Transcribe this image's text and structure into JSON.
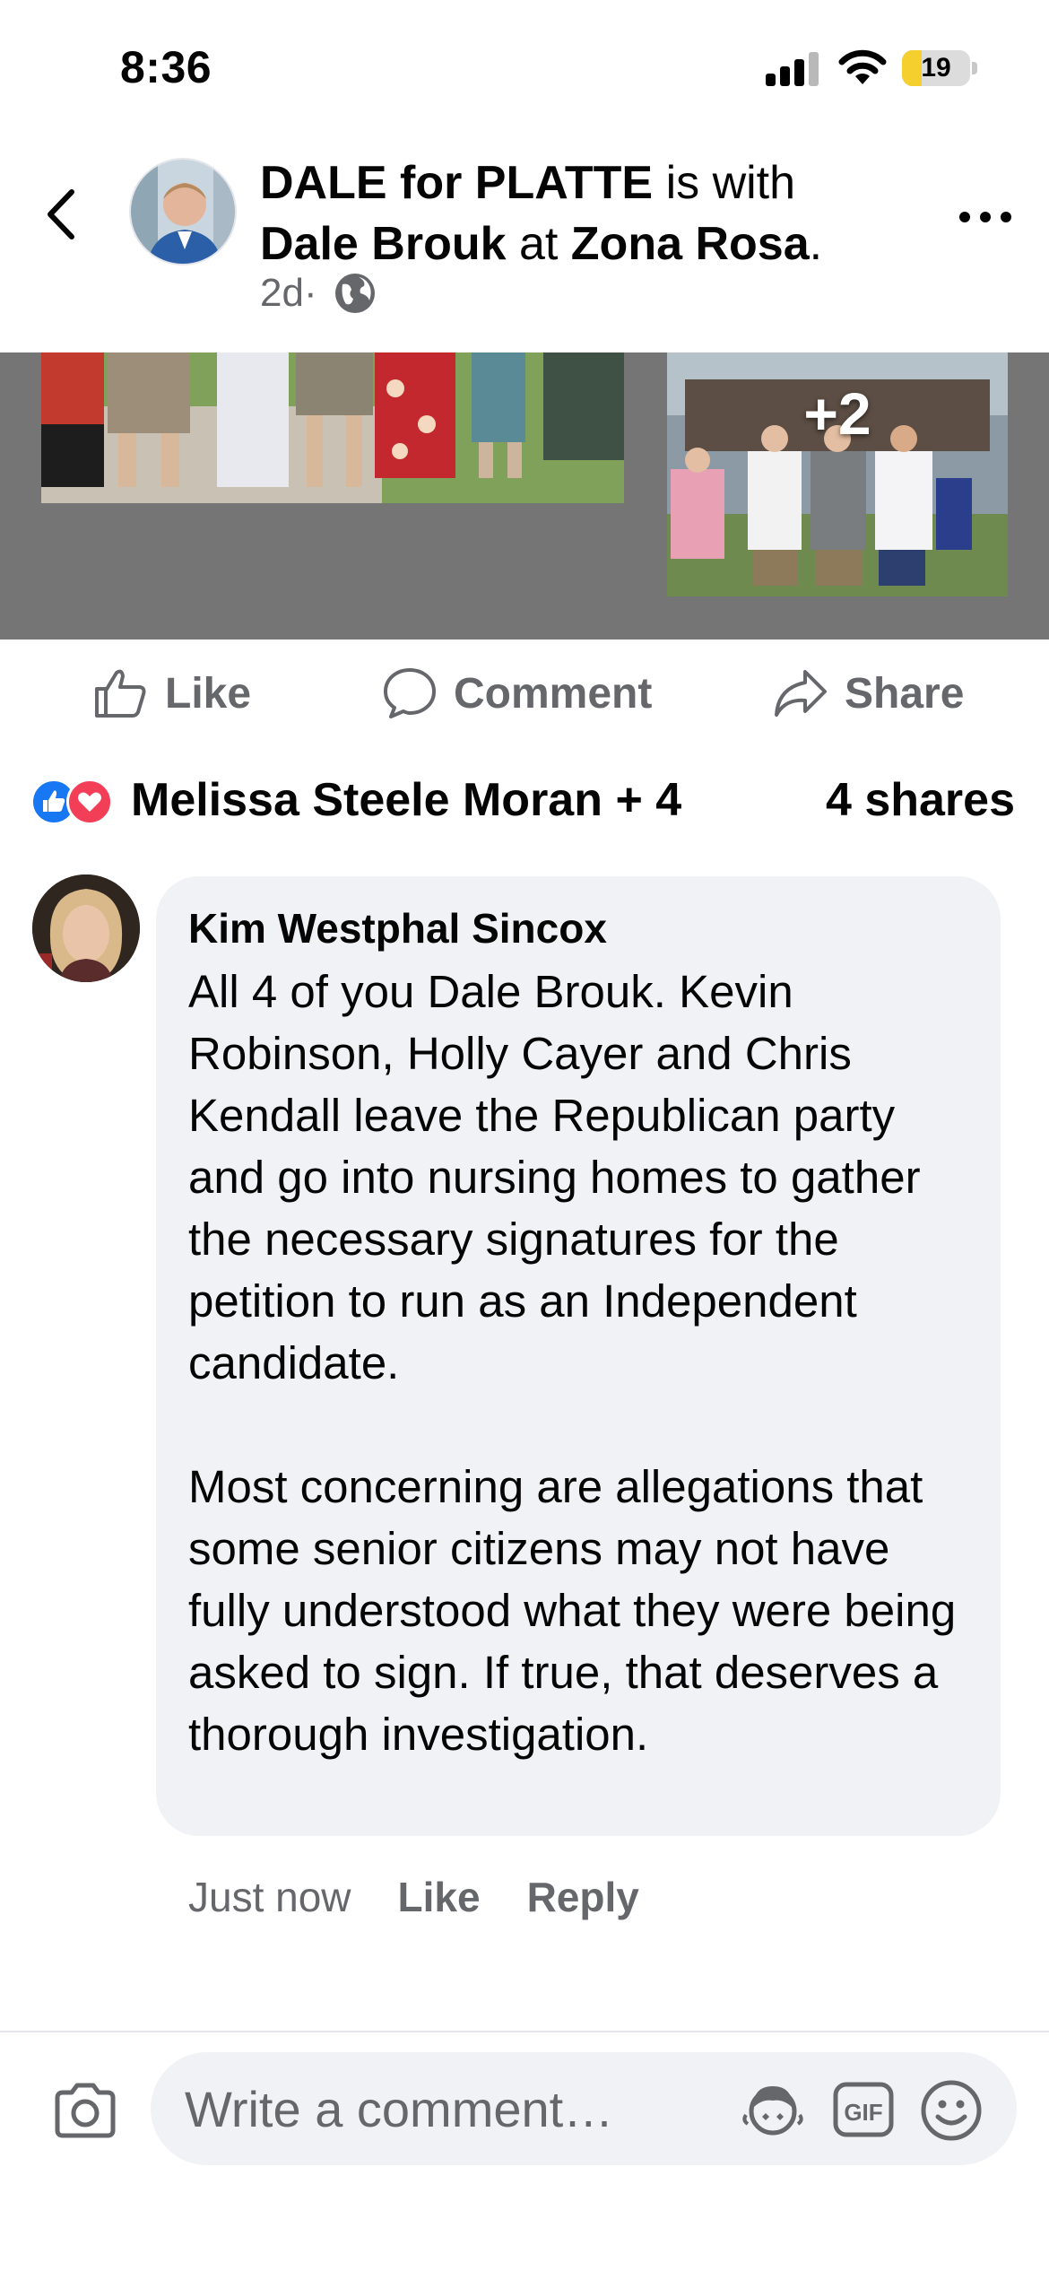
{
  "status_bar": {
    "time": "8:36",
    "battery_level": "19"
  },
  "post": {
    "page_name": "DALE for PLATTE",
    "is_with_text": " is with",
    "tagged_person": "Dale Brouk",
    "at_text": " at ",
    "location": "Zona Rosa",
    "period": ".",
    "age": "2d",
    "separator": " · ",
    "audience_icon": "globe-icon",
    "photo_more_count": "+2"
  },
  "actions": {
    "like_label": "Like",
    "comment_label": "Comment",
    "share_label": "Share"
  },
  "reactions": {
    "icons": [
      "like-icon",
      "love-icon"
    ],
    "summary": "Melissa Steele Moran + 4",
    "shares": "4 shares"
  },
  "comment": {
    "author": "Kim Westphal Sincox",
    "paragraph_1": "All 4 of you Dale Brouk. Kevin Robinson, Holly Cayer and Chris Kendall leave the Republican party and go into nursing homes to gather the necessary signatures for the petition to run as an Independent candidate.",
    "paragraph_2": "Most concerning are allegations that some senior citizens may not have fully understood what they were being asked to sign. If true, that deserves a thorough investigation.",
    "time": "Just now",
    "like_label": "Like",
    "reply_label": "Reply"
  },
  "composer": {
    "placeholder": "Write a comment…",
    "gif_label": "GIF"
  },
  "colors": {
    "brand_blue": "#1877f2",
    "love_red": "#f33e58",
    "secondary_text": "#65676b",
    "bubble_bg": "#f0f2f5",
    "battery_yellow": "#f5cf2e"
  }
}
